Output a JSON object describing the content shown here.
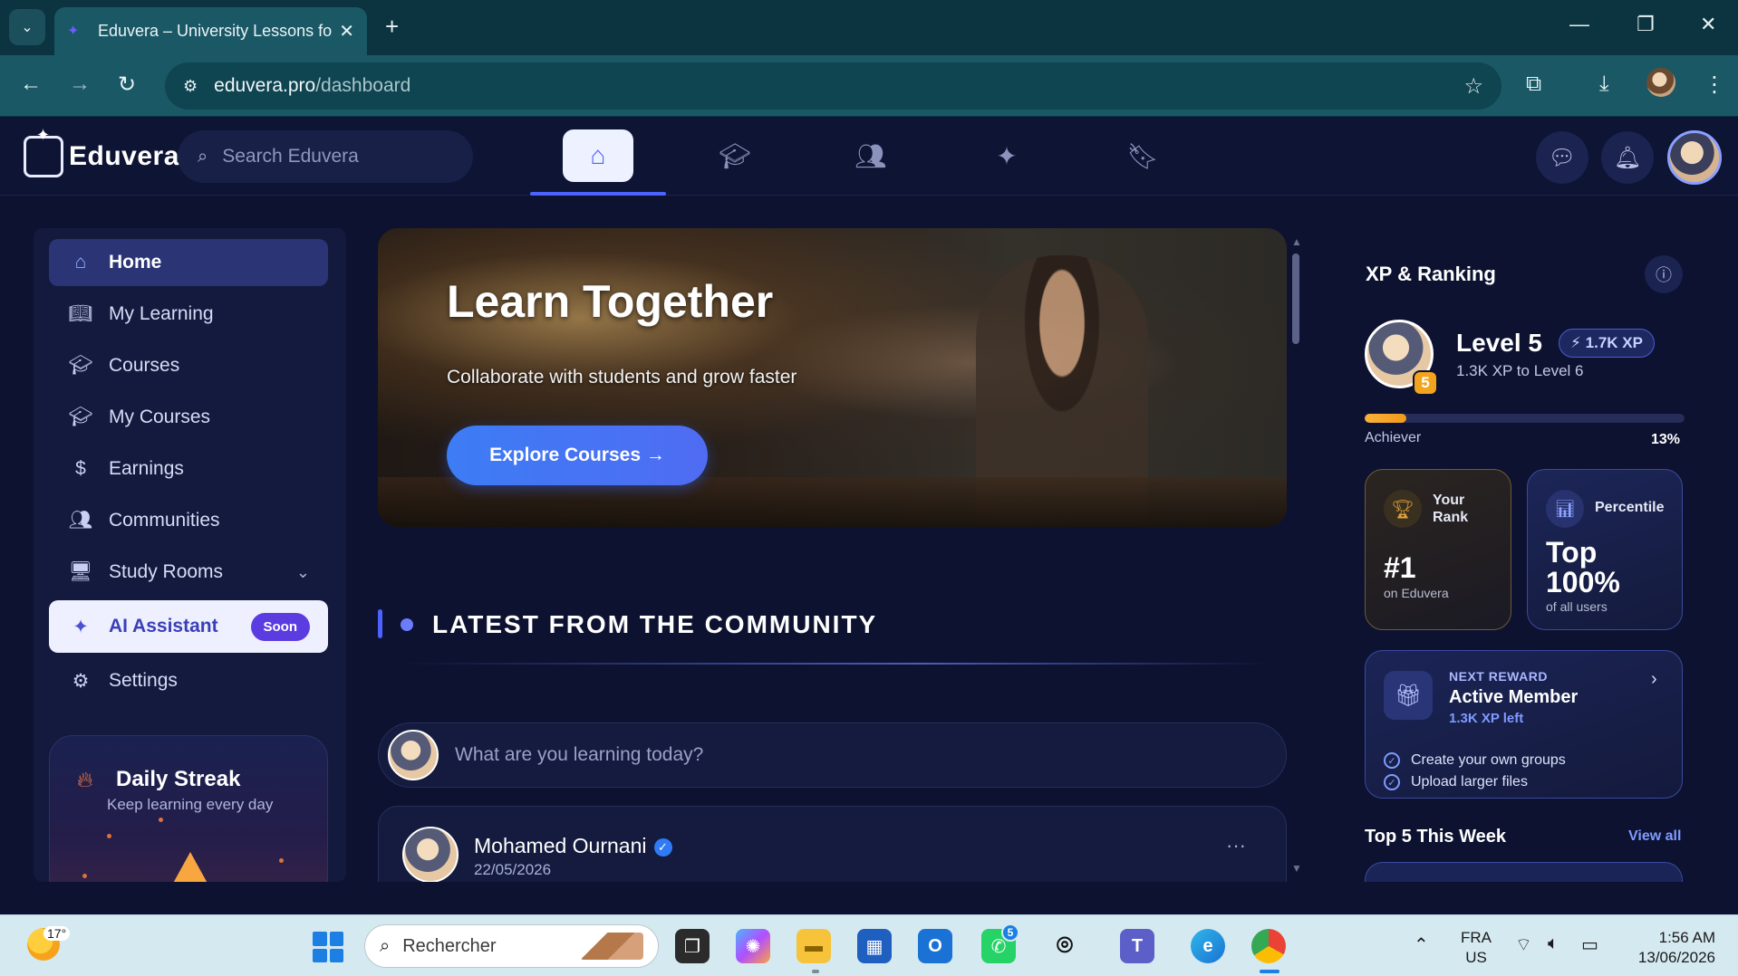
{
  "browser": {
    "tab_title": "Eduvera – University Lessons fo",
    "url_host": "eduvera.pro",
    "url_path": "/dashboard"
  },
  "app": {
    "logo_text": "Eduvera",
    "search_placeholder": "Search Eduvera",
    "nav_tabs": [
      {
        "name": "home",
        "icon": "home-icon",
        "active": true
      },
      {
        "name": "learning",
        "icon": "graduation-cap-icon",
        "active": false
      },
      {
        "name": "people",
        "icon": "people-icon",
        "active": false
      },
      {
        "name": "ai",
        "icon": "sparkles-icon",
        "active": false
      },
      {
        "name": "saved",
        "icon": "bookmark-icon",
        "active": false
      }
    ],
    "accent_color": "#4c63ff"
  },
  "sidebar": {
    "items": [
      {
        "label": "Home",
        "icon": "home-icon"
      },
      {
        "label": "My Learning",
        "icon": "book-icon"
      },
      {
        "label": "Courses",
        "icon": "graduation-cap-icon"
      },
      {
        "label": "My Courses",
        "icon": "graduation-cap-icon"
      },
      {
        "label": "Earnings",
        "icon": "dollar-icon"
      },
      {
        "label": "Communities",
        "icon": "people-icon"
      },
      {
        "label": "Study Rooms",
        "icon": "monitor-icon"
      },
      {
        "label": "AI Assistant",
        "icon": "sparkles-icon",
        "badge": "Soon"
      },
      {
        "label": "Settings",
        "icon": "gear-icon"
      }
    ],
    "streak": {
      "title": "Daily Streak",
      "subtitle": "Keep learning every day"
    }
  },
  "hero": {
    "title": "Learn Together",
    "subtitle": "Collaborate with students and grow faster",
    "button": "Explore Courses →"
  },
  "community": {
    "heading": "LATEST FROM THE COMMUNITY",
    "composer_placeholder": "What are you learning today?",
    "post": {
      "author": "Mohamed Ournani",
      "date": "22/05/2026",
      "more": "···"
    }
  },
  "xp": {
    "title": "XP & Ranking",
    "level": "Level 5",
    "level_badge": "5",
    "xp_pill": "⚡ 1.7K XP",
    "next_level": "1.3K XP to Level 6",
    "tier": "Achiever",
    "progress_pct": "13%",
    "progress_fraction": 0.13,
    "rank": {
      "label": "Your Rank",
      "value": "#1",
      "sub": "on Eduvera"
    },
    "percentile": {
      "label": "Percentile",
      "value": "Top 100%",
      "sub": "of all users"
    },
    "reward": {
      "kicker": "NEXT REWARD",
      "name": "Active Member",
      "xp_left": "1.3K XP left",
      "perks": [
        "Create your own groups",
        "Upload larger files"
      ]
    },
    "top5_title": "Top 5 This Week",
    "top5_link": "View all"
  },
  "taskbar": {
    "weather_temp": "17°",
    "search_text": "Rechercher",
    "whatsapp_badge": "5",
    "lang_1": "FRA",
    "lang_2": "US",
    "time": "1:56 AM",
    "date": "13/06/2026"
  }
}
